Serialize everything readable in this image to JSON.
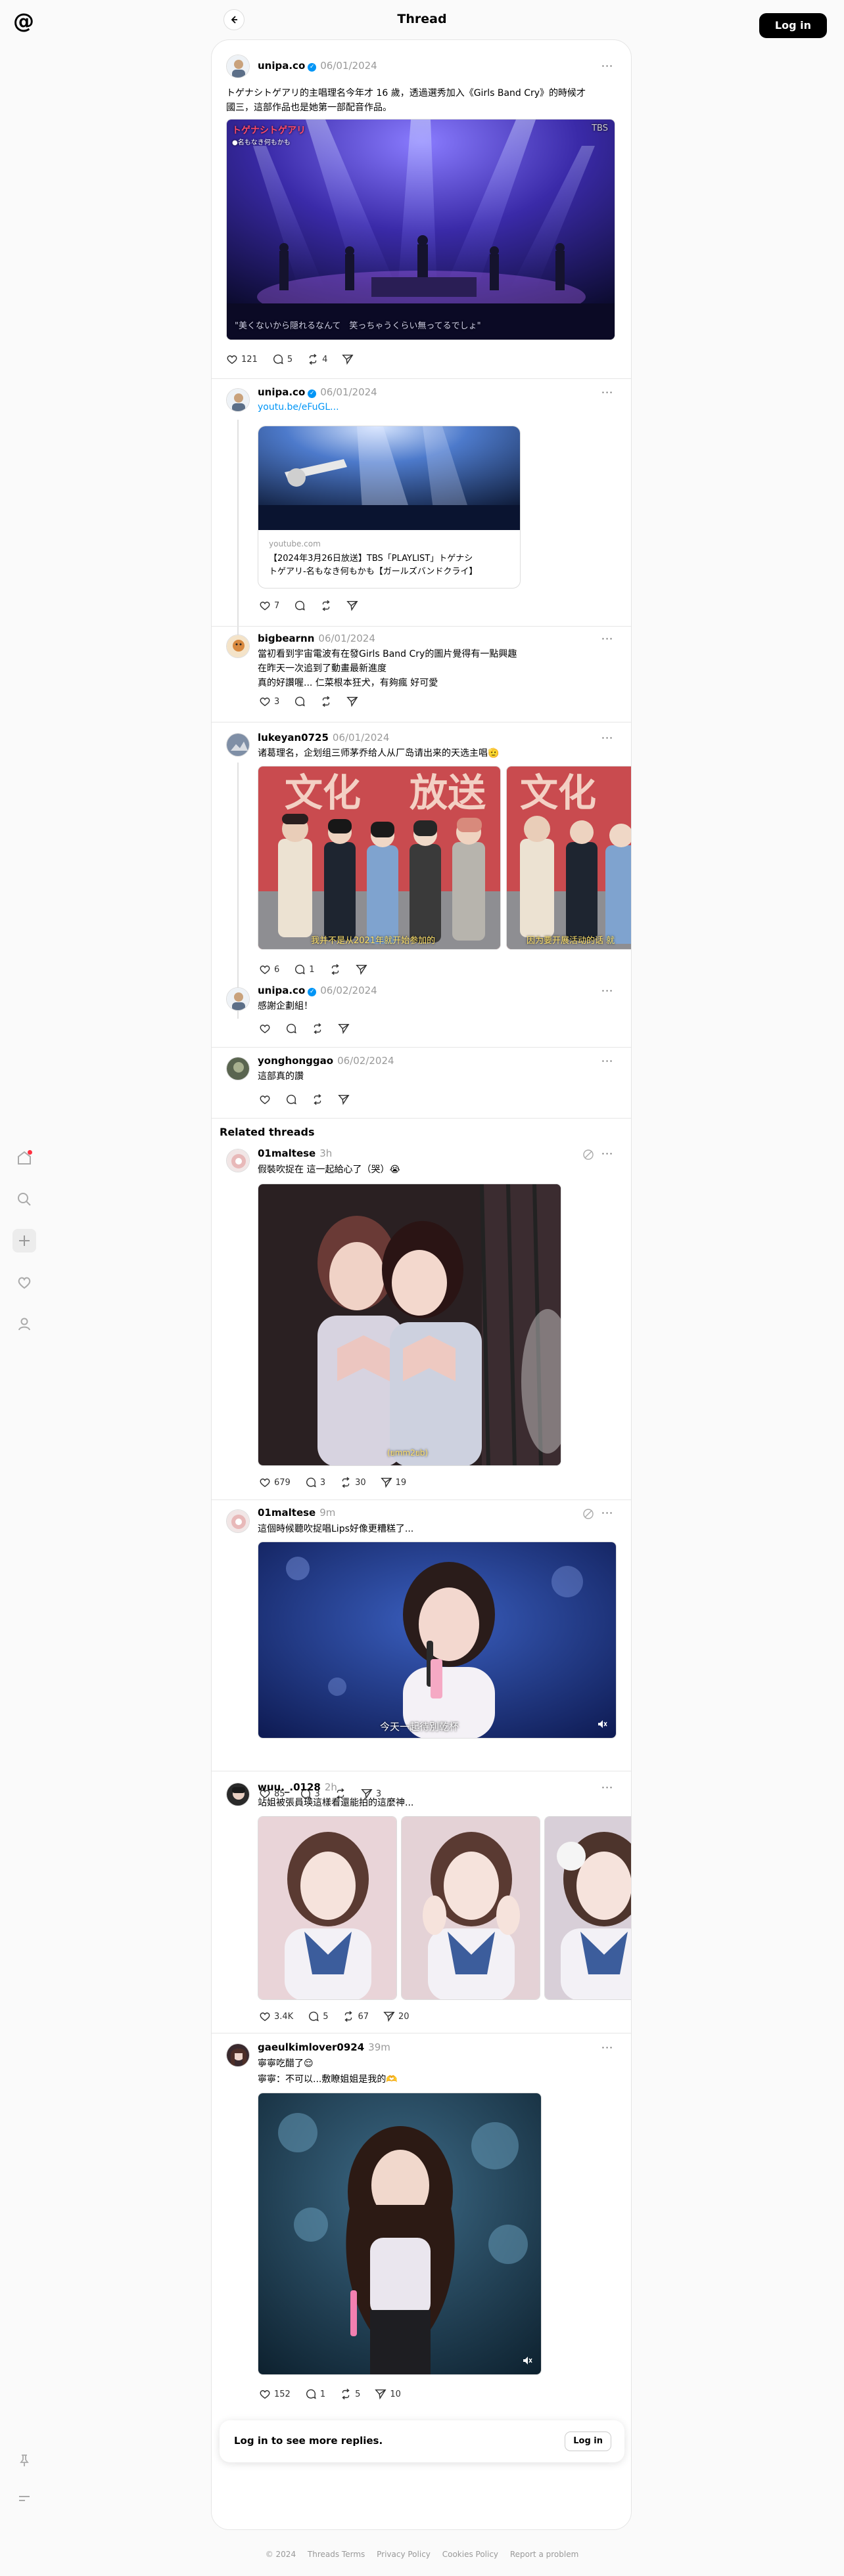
{
  "header": {
    "title": "Thread",
    "login_label": "Log in"
  },
  "sidebar": {
    "icons": [
      "home-icon",
      "search-icon",
      "create-icon",
      "activity-icon",
      "profile-icon"
    ],
    "bottom_icons": [
      "pin-icon",
      "menu-icon"
    ]
  },
  "posts": [
    {
      "username": "unipa.co",
      "verified": true,
      "time": "06/01/2024",
      "text_lines": [
        "トゲナシトゲアリ的主唱理名今年才 16 歲，透過選秀加入《Girls Band Cry》的時候才",
        "國三，這部作品也是她第一部配音作品。"
      ],
      "media_overlay": {
        "top_left": "トゲナシトゲアリ",
        "top_left_sub": "●名もなき何もかも",
        "top_right": "TBS",
        "subtitle": "\"美くないから隠れるなんて　笑っちゃうくらい無ってるでしょ\""
      },
      "likes": "121",
      "replies": "5",
      "reposts": "4"
    },
    {
      "username": "unipa.co",
      "verified": true,
      "time": "06/01/2024",
      "link": "youtu.be/eFuGL...",
      "card": {
        "domain": "youtube.com",
        "title_lines": [
          "【2024年3月26日放送】TBS「PLAYLIST」トゲナシ",
          "トゲアリ-名もなき何もかも【ガールズバンドクライ】"
        ]
      },
      "likes": "7"
    },
    {
      "username": "bigbearnn",
      "time": "06/01/2024",
      "text_lines": [
        "當初看到宇宙電波有在發Girls Band Cry的圖片覺得有一點興趣",
        "在昨天一次追到了動畫最新進度",
        "真的好讚喔... 仁菜根本狂犬，有夠瘋 好可愛"
      ],
      "likes": "3"
    },
    {
      "username": "lukeyan0725",
      "time": "06/01/2024",
      "text_lines": [
        "诸葛理名，企划组三师茅乔给人从厂岛请出来的天选主唱🫡"
      ],
      "media_caption_1": "我并不是从2021年就开始参加的",
      "media_caption_2": "因为要开展活动的话 就",
      "likes": "6",
      "replies": "1"
    },
    {
      "username": "unipa.co",
      "verified": true,
      "time": "06/02/2024",
      "text_lines": [
        "感謝企劃組！"
      ]
    },
    {
      "username": "yonghonggao",
      "time": "06/02/2024",
      "text_lines": [
        "這部真的讚"
      ]
    }
  ],
  "related": {
    "title": "Related threads",
    "items": [
      {
        "username": "01maltese",
        "time": "3h",
        "text_lines": [
          "假裝吹捉在 這一起給心了（哭）😭"
        ],
        "media_caption": "(ยmm2ยb)",
        "likes": "679",
        "replies": "3",
        "reposts": "30",
        "shares": "19"
      },
      {
        "username": "01maltese",
        "time": "9m",
        "text_lines": [
          "這個時候聽吹捉唱Lips好像更糟糕了..."
        ],
        "media_caption": "今天一起待別乾杯",
        "likes": "85",
        "replies": "3",
        "shares": "3"
      },
      {
        "username": "wuu._.0128",
        "time": "2h",
        "text_lines": [
          "站姐被張員瑛這樣看還能拍的這麼神..."
        ],
        "likes": "3.4K",
        "replies": "5",
        "reposts": "67",
        "shares": "20"
      },
      {
        "username": "gaeulkimlover0924",
        "time": "39m",
        "text_lines": [
          "寧寧吃醋了😌",
          "寧寧：不可以...敷瞭姐姐是我的🫶"
        ],
        "likes": "152",
        "replies": "1",
        "reposts": "5",
        "shares": "10"
      }
    ]
  },
  "login_prompt": {
    "text": "Log in to see more replies.",
    "button": "Log in"
  },
  "footer": [
    "© 2024",
    "Threads Terms",
    "Privacy Policy",
    "Cookies Policy",
    "Report a problem"
  ],
  "colors": {
    "accent_link": "#0095f6",
    "notification_dot": "#ff3040",
    "button_dark": "#000000"
  }
}
